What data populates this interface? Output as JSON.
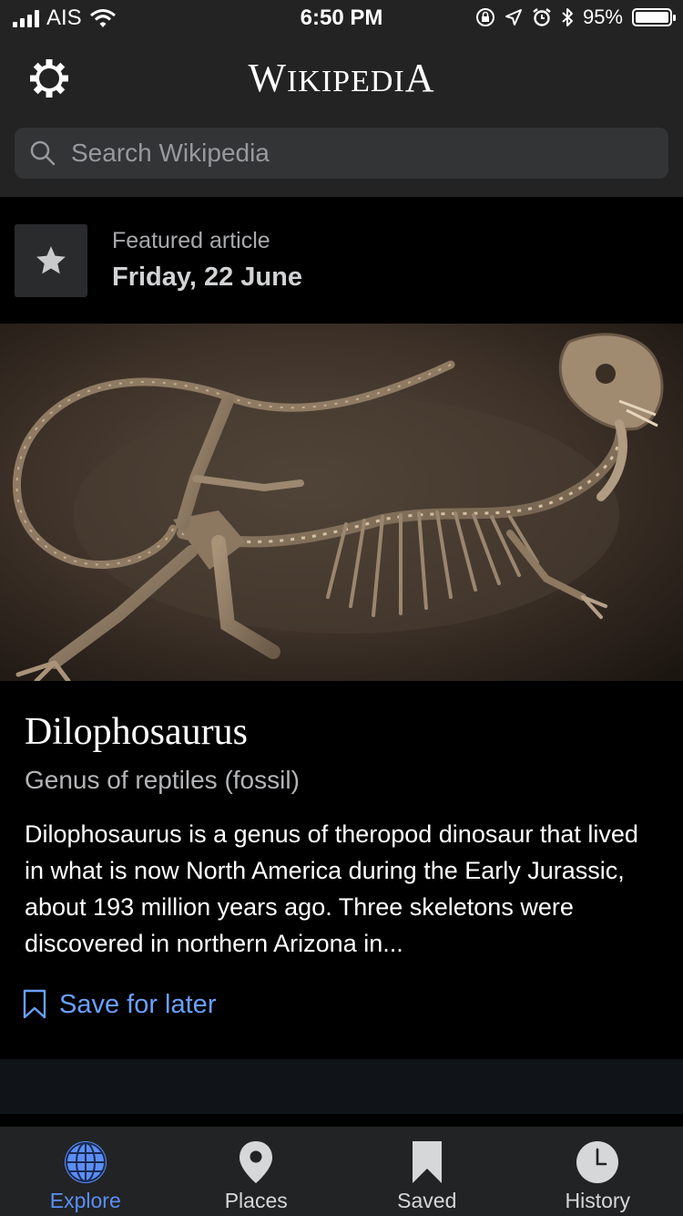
{
  "status_bar": {
    "carrier": "AIS",
    "time": "6:50 PM",
    "battery": "95%",
    "icons": [
      "signal-icon",
      "wifi-icon",
      "orientation-lock-icon",
      "location-icon",
      "alarm-icon",
      "bluetooth-icon",
      "battery-icon"
    ]
  },
  "header": {
    "brand": {
      "first": "W",
      "rest": "IKIPEDI",
      "last": "A"
    },
    "settings_icon": "gear-icon",
    "search": {
      "placeholder": "Search Wikipedia",
      "value": ""
    }
  },
  "featured": {
    "icon": "star-icon",
    "label": "Featured article",
    "date": "Friday, 22 June"
  },
  "article": {
    "image": "dilophosaurus-fossil-photo",
    "title": "Dilophosaurus",
    "description": "Genus of reptiles (fossil)",
    "extract": "Dilophosaurus is a genus of theropod dinosaur that lived in what is now North America during the Early Jurassic, about 193 million years ago. Three skeletons were discovered in northern Arizona in...",
    "save_label": "Save for later",
    "save_icon": "bookmark-outline-icon"
  },
  "tab_bar": {
    "active": "Explore",
    "tabs": [
      {
        "label": "Explore",
        "icon": "globe-icon"
      },
      {
        "label": "Places",
        "icon": "map-pin-icon"
      },
      {
        "label": "Saved",
        "icon": "bookmark-icon"
      },
      {
        "label": "History",
        "icon": "clock-icon"
      }
    ]
  },
  "colors": {
    "accent": "#5b8ef5",
    "link": "#6aa0ff",
    "header_bg": "#232323",
    "search_bg": "#323436",
    "tab_bar_bg": "#222325"
  }
}
